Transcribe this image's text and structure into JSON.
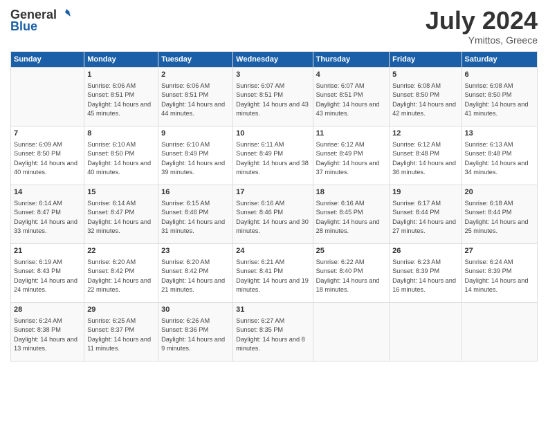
{
  "header": {
    "logo_line1": "General",
    "logo_line2": "Blue",
    "month_year": "July 2024",
    "location": "Ymittos, Greece"
  },
  "days_of_week": [
    "Sunday",
    "Monday",
    "Tuesday",
    "Wednesday",
    "Thursday",
    "Friday",
    "Saturday"
  ],
  "weeks": [
    [
      {
        "day": "",
        "sunrise": "",
        "sunset": "",
        "daylight": ""
      },
      {
        "day": "1",
        "sunrise": "Sunrise: 6:06 AM",
        "sunset": "Sunset: 8:51 PM",
        "daylight": "Daylight: 14 hours and 45 minutes."
      },
      {
        "day": "2",
        "sunrise": "Sunrise: 6:06 AM",
        "sunset": "Sunset: 8:51 PM",
        "daylight": "Daylight: 14 hours and 44 minutes."
      },
      {
        "day": "3",
        "sunrise": "Sunrise: 6:07 AM",
        "sunset": "Sunset: 8:51 PM",
        "daylight": "Daylight: 14 hours and 43 minutes."
      },
      {
        "day": "4",
        "sunrise": "Sunrise: 6:07 AM",
        "sunset": "Sunset: 8:51 PM",
        "daylight": "Daylight: 14 hours and 43 minutes."
      },
      {
        "day": "5",
        "sunrise": "Sunrise: 6:08 AM",
        "sunset": "Sunset: 8:50 PM",
        "daylight": "Daylight: 14 hours and 42 minutes."
      },
      {
        "day": "6",
        "sunrise": "Sunrise: 6:08 AM",
        "sunset": "Sunset: 8:50 PM",
        "daylight": "Daylight: 14 hours and 41 minutes."
      }
    ],
    [
      {
        "day": "7",
        "sunrise": "Sunrise: 6:09 AM",
        "sunset": "Sunset: 8:50 PM",
        "daylight": "Daylight: 14 hours and 40 minutes."
      },
      {
        "day": "8",
        "sunrise": "Sunrise: 6:10 AM",
        "sunset": "Sunset: 8:50 PM",
        "daylight": "Daylight: 14 hours and 40 minutes."
      },
      {
        "day": "9",
        "sunrise": "Sunrise: 6:10 AM",
        "sunset": "Sunset: 8:49 PM",
        "daylight": "Daylight: 14 hours and 39 minutes."
      },
      {
        "day": "10",
        "sunrise": "Sunrise: 6:11 AM",
        "sunset": "Sunset: 8:49 PM",
        "daylight": "Daylight: 14 hours and 38 minutes."
      },
      {
        "day": "11",
        "sunrise": "Sunrise: 6:12 AM",
        "sunset": "Sunset: 8:49 PM",
        "daylight": "Daylight: 14 hours and 37 minutes."
      },
      {
        "day": "12",
        "sunrise": "Sunrise: 6:12 AM",
        "sunset": "Sunset: 8:48 PM",
        "daylight": "Daylight: 14 hours and 36 minutes."
      },
      {
        "day": "13",
        "sunrise": "Sunrise: 6:13 AM",
        "sunset": "Sunset: 8:48 PM",
        "daylight": "Daylight: 14 hours and 34 minutes."
      }
    ],
    [
      {
        "day": "14",
        "sunrise": "Sunrise: 6:14 AM",
        "sunset": "Sunset: 8:47 PM",
        "daylight": "Daylight: 14 hours and 33 minutes."
      },
      {
        "day": "15",
        "sunrise": "Sunrise: 6:14 AM",
        "sunset": "Sunset: 8:47 PM",
        "daylight": "Daylight: 14 hours and 32 minutes."
      },
      {
        "day": "16",
        "sunrise": "Sunrise: 6:15 AM",
        "sunset": "Sunset: 8:46 PM",
        "daylight": "Daylight: 14 hours and 31 minutes."
      },
      {
        "day": "17",
        "sunrise": "Sunrise: 6:16 AM",
        "sunset": "Sunset: 8:46 PM",
        "daylight": "Daylight: 14 hours and 30 minutes."
      },
      {
        "day": "18",
        "sunrise": "Sunrise: 6:16 AM",
        "sunset": "Sunset: 8:45 PM",
        "daylight": "Daylight: 14 hours and 28 minutes."
      },
      {
        "day": "19",
        "sunrise": "Sunrise: 6:17 AM",
        "sunset": "Sunset: 8:44 PM",
        "daylight": "Daylight: 14 hours and 27 minutes."
      },
      {
        "day": "20",
        "sunrise": "Sunrise: 6:18 AM",
        "sunset": "Sunset: 8:44 PM",
        "daylight": "Daylight: 14 hours and 25 minutes."
      }
    ],
    [
      {
        "day": "21",
        "sunrise": "Sunrise: 6:19 AM",
        "sunset": "Sunset: 8:43 PM",
        "daylight": "Daylight: 14 hours and 24 minutes."
      },
      {
        "day": "22",
        "sunrise": "Sunrise: 6:20 AM",
        "sunset": "Sunset: 8:42 PM",
        "daylight": "Daylight: 14 hours and 22 minutes."
      },
      {
        "day": "23",
        "sunrise": "Sunrise: 6:20 AM",
        "sunset": "Sunset: 8:42 PM",
        "daylight": "Daylight: 14 hours and 21 minutes."
      },
      {
        "day": "24",
        "sunrise": "Sunrise: 6:21 AM",
        "sunset": "Sunset: 8:41 PM",
        "daylight": "Daylight: 14 hours and 19 minutes."
      },
      {
        "day": "25",
        "sunrise": "Sunrise: 6:22 AM",
        "sunset": "Sunset: 8:40 PM",
        "daylight": "Daylight: 14 hours and 18 minutes."
      },
      {
        "day": "26",
        "sunrise": "Sunrise: 6:23 AM",
        "sunset": "Sunset: 8:39 PM",
        "daylight": "Daylight: 14 hours and 16 minutes."
      },
      {
        "day": "27",
        "sunrise": "Sunrise: 6:24 AM",
        "sunset": "Sunset: 8:39 PM",
        "daylight": "Daylight: 14 hours and 14 minutes."
      }
    ],
    [
      {
        "day": "28",
        "sunrise": "Sunrise: 6:24 AM",
        "sunset": "Sunset: 8:38 PM",
        "daylight": "Daylight: 14 hours and 13 minutes."
      },
      {
        "day": "29",
        "sunrise": "Sunrise: 6:25 AM",
        "sunset": "Sunset: 8:37 PM",
        "daylight": "Daylight: 14 hours and 11 minutes."
      },
      {
        "day": "30",
        "sunrise": "Sunrise: 6:26 AM",
        "sunset": "Sunset: 8:36 PM",
        "daylight": "Daylight: 14 hours and 9 minutes."
      },
      {
        "day": "31",
        "sunrise": "Sunrise: 6:27 AM",
        "sunset": "Sunset: 8:35 PM",
        "daylight": "Daylight: 14 hours and 8 minutes."
      },
      {
        "day": "",
        "sunrise": "",
        "sunset": "",
        "daylight": ""
      },
      {
        "day": "",
        "sunrise": "",
        "sunset": "",
        "daylight": ""
      },
      {
        "day": "",
        "sunrise": "",
        "sunset": "",
        "daylight": ""
      }
    ]
  ]
}
